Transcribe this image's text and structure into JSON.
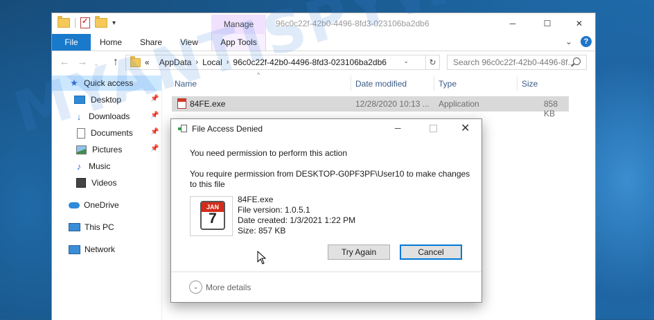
{
  "window": {
    "title_path": "96c0c22f-42b0-4496-8fd3-023106ba2db6",
    "manage_label": "Manage",
    "minimize_symbol": "─",
    "maximize_symbol": "☐",
    "close_symbol": "✕"
  },
  "ribbon": {
    "tabs": [
      "File",
      "Home",
      "Share",
      "View",
      "App Tools"
    ],
    "chevron": "⌄",
    "help": "?"
  },
  "address": {
    "prefix": "«",
    "crumbs": [
      "AppData",
      "Local",
      "96c0c22f-42b0-4496-8fd3-023106ba2db6"
    ],
    "refresh": "↻",
    "dropdown": "⌄"
  },
  "search": {
    "placeholder": "Search 96c0c22f-42b0-4496-8f..."
  },
  "sidebar": {
    "items": [
      {
        "label": "Quick access",
        "icon": "star-icon"
      },
      {
        "label": "Desktop",
        "icon": "desktop-icon",
        "pinned": true
      },
      {
        "label": "Downloads",
        "icon": "download-icon",
        "pinned": true
      },
      {
        "label": "Documents",
        "icon": "document-icon",
        "pinned": true
      },
      {
        "label": "Pictures",
        "icon": "pictures-icon",
        "pinned": true
      },
      {
        "label": "Music",
        "icon": "music-icon"
      },
      {
        "label": "Videos",
        "icon": "video-icon"
      },
      {
        "label": "OneDrive",
        "icon": "cloud-icon"
      },
      {
        "label": "This PC",
        "icon": "computer-icon"
      },
      {
        "label": "Network",
        "icon": "network-icon"
      }
    ]
  },
  "table": {
    "columns": [
      "Name",
      "Date modified",
      "Type",
      "Size"
    ],
    "rows": [
      {
        "name": "84FE.exe",
        "date": "12/28/2020 10:13 ...",
        "type": "Application",
        "size": "858 KB"
      }
    ]
  },
  "dialog": {
    "title": "File Access Denied",
    "message1": "You need permission to perform this action",
    "message2": "You require permission from DESKTOP-G0PF3PF\\User10 to make changes to this file",
    "file_icon": {
      "month": "JAN",
      "day": "7"
    },
    "file_name": "84FE.exe",
    "file_version": "File version: 1.0.5.1",
    "date_created": "Date created: 1/3/2021 1:22 PM",
    "size": "Size: 857 KB",
    "try_again": "Try Again",
    "cancel": "Cancel",
    "more_details": "More details"
  },
  "watermark": "MYANTISPYWARE.COM"
}
